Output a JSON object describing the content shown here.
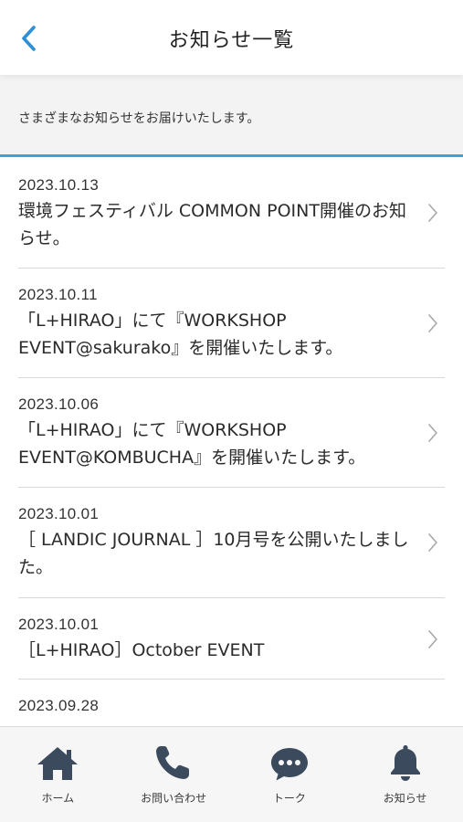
{
  "header": {
    "title": "お知らせ一覧",
    "back_icon": "chevron-left-icon",
    "accent_color": "#2f8fd6"
  },
  "intro": {
    "text": "さまざまなお知らせをお届けいたします。",
    "accent_color": "#3aa3dc"
  },
  "news": [
    {
      "date": "2023.10.13",
      "title": "環境フェスティバル COMMON POINT開催のお知らせ。"
    },
    {
      "date": "2023.10.11",
      "title": "「L+HIRAO」にて『WORKSHOP EVENT@sakurako』を開催いたします。"
    },
    {
      "date": "2023.10.06",
      "title": "「L+HIRAO」にて『WORKSHOP EVENT@KOMBUCHA』を開催いたします。"
    },
    {
      "date": "2023.10.01",
      "title": "［ LANDIC JOURNAL ］10月号を公開いたしました。"
    },
    {
      "date": "2023.10.01",
      "title": "［L+HIRAO］October EVENT"
    },
    {
      "date": "2023.09.28",
      "title": ""
    }
  ],
  "tabbar": {
    "items": [
      {
        "label": "ホーム",
        "icon": "home-icon"
      },
      {
        "label": "お問い合わせ",
        "icon": "phone-icon"
      },
      {
        "label": "トーク",
        "icon": "chat-bubble-icon"
      },
      {
        "label": "お知らせ",
        "icon": "bell-icon"
      }
    ],
    "icon_color": "#3b4a5c"
  }
}
